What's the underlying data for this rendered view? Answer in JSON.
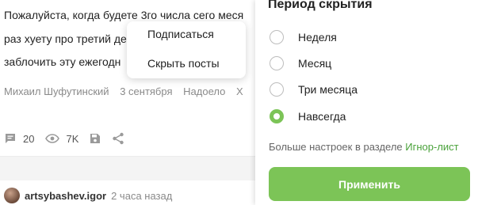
{
  "post": {
    "lines": [
      "Пожалуйста, когда будете 3го числа сего меся",
      "раз хуету про третий де",
      "заблочить эту ежегодн"
    ],
    "meta": {
      "author": "Михаил Шуфутинский",
      "date": "3 сентября",
      "tag": "Надоело",
      "more": "Х"
    },
    "stats": {
      "comments": "20",
      "views": "7K"
    }
  },
  "dropdown": {
    "items": [
      "Подписаться",
      "Скрыть посты"
    ]
  },
  "next_post": {
    "author": "artsybashev.igor",
    "time": "2 часа назад"
  },
  "panel": {
    "title": "Период скрытия",
    "options": [
      {
        "label": "Неделя",
        "checked": false
      },
      {
        "label": "Месяц",
        "checked": false
      },
      {
        "label": "Три месяца",
        "checked": false
      },
      {
        "label": "Навсегда",
        "checked": true
      }
    ],
    "more_text": "Больше настроек в разделе ",
    "more_link": "Игнор-лист",
    "apply_label": "Применить",
    "accent_color": "#7cc457"
  }
}
